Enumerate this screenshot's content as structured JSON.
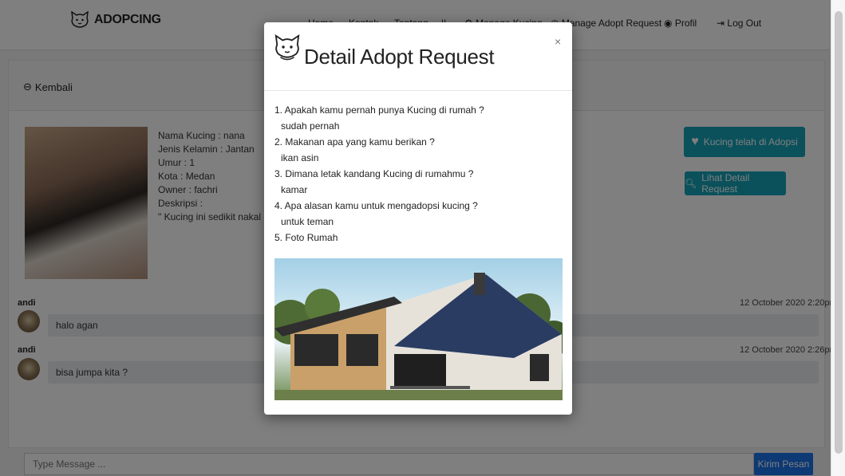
{
  "navbar": {
    "brand": "ADOPCING",
    "items": [
      "Home",
      "Kontak",
      "Tentang",
      "||",
      "Menage Kucing",
      "Manage Adopt Request",
      "Profil",
      "Log Out"
    ]
  },
  "page": {
    "back_label": "Kembali",
    "cat_info": [
      "Nama Kucing : nana",
      "Jenis Kelamin : Jantan",
      "Umur : 1",
      "Kota : Medan",
      "Owner : fachri",
      "Deskripsi :",
      "\" Kucing ini sedikit nakal dan s"
    ],
    "adopted_button": "Kucing telah di Adopsi",
    "detail_button": "Lihat Detail Request"
  },
  "chat": [
    {
      "name": "andi",
      "message": "halo agan",
      "time": "12 October 2020 2:20pm"
    },
    {
      "name": "andi",
      "message": "bisa jumpa kita ?",
      "time": "12 October 2020 2:26pm"
    }
  ],
  "composer": {
    "placeholder": "Type Message ...",
    "send_label": "Kirim Pesan"
  },
  "modal": {
    "title": "Detail Adopt Request",
    "close": "×",
    "questions": [
      {
        "q": "1. Apakah kamu pernah punya Kucing di rumah ?",
        "a": "sudah pernah"
      },
      {
        "q": "2. Makanan apa yang kamu berikan ?",
        "a": "ikan asin"
      },
      {
        "q": "3. Dimana letak kandang Kucing di rumahmu ?",
        "a": "kamar"
      },
      {
        "q": "4. Apa alasan kamu untuk mengadopsi kucing ?",
        "a": "untuk teman"
      },
      {
        "q": "5. Foto Rumah",
        "a": ""
      }
    ]
  },
  "colors": {
    "teal": "#17a2b8",
    "send_blue": "#1a73e8",
    "overlay": "rgba(0,0,0,0.5)"
  }
}
